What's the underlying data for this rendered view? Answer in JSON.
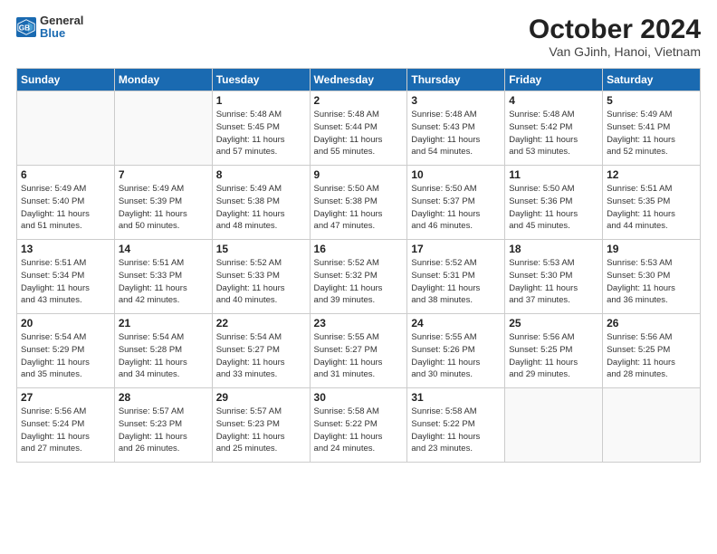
{
  "header": {
    "logo_general": "General",
    "logo_blue": "Blue",
    "title": "October 2024",
    "subtitle": "Van GJinh, Hanoi, Vietnam"
  },
  "weekdays": [
    "Sunday",
    "Monday",
    "Tuesday",
    "Wednesday",
    "Thursday",
    "Friday",
    "Saturday"
  ],
  "weeks": [
    [
      {
        "day": "",
        "info": ""
      },
      {
        "day": "",
        "info": ""
      },
      {
        "day": "1",
        "info": "Sunrise: 5:48 AM\nSunset: 5:45 PM\nDaylight: 11 hours\nand 57 minutes."
      },
      {
        "day": "2",
        "info": "Sunrise: 5:48 AM\nSunset: 5:44 PM\nDaylight: 11 hours\nand 55 minutes."
      },
      {
        "day": "3",
        "info": "Sunrise: 5:48 AM\nSunset: 5:43 PM\nDaylight: 11 hours\nand 54 minutes."
      },
      {
        "day": "4",
        "info": "Sunrise: 5:48 AM\nSunset: 5:42 PM\nDaylight: 11 hours\nand 53 minutes."
      },
      {
        "day": "5",
        "info": "Sunrise: 5:49 AM\nSunset: 5:41 PM\nDaylight: 11 hours\nand 52 minutes."
      }
    ],
    [
      {
        "day": "6",
        "info": "Sunrise: 5:49 AM\nSunset: 5:40 PM\nDaylight: 11 hours\nand 51 minutes."
      },
      {
        "day": "7",
        "info": "Sunrise: 5:49 AM\nSunset: 5:39 PM\nDaylight: 11 hours\nand 50 minutes."
      },
      {
        "day": "8",
        "info": "Sunrise: 5:49 AM\nSunset: 5:38 PM\nDaylight: 11 hours\nand 48 minutes."
      },
      {
        "day": "9",
        "info": "Sunrise: 5:50 AM\nSunset: 5:38 PM\nDaylight: 11 hours\nand 47 minutes."
      },
      {
        "day": "10",
        "info": "Sunrise: 5:50 AM\nSunset: 5:37 PM\nDaylight: 11 hours\nand 46 minutes."
      },
      {
        "day": "11",
        "info": "Sunrise: 5:50 AM\nSunset: 5:36 PM\nDaylight: 11 hours\nand 45 minutes."
      },
      {
        "day": "12",
        "info": "Sunrise: 5:51 AM\nSunset: 5:35 PM\nDaylight: 11 hours\nand 44 minutes."
      }
    ],
    [
      {
        "day": "13",
        "info": "Sunrise: 5:51 AM\nSunset: 5:34 PM\nDaylight: 11 hours\nand 43 minutes."
      },
      {
        "day": "14",
        "info": "Sunrise: 5:51 AM\nSunset: 5:33 PM\nDaylight: 11 hours\nand 42 minutes."
      },
      {
        "day": "15",
        "info": "Sunrise: 5:52 AM\nSunset: 5:33 PM\nDaylight: 11 hours\nand 40 minutes."
      },
      {
        "day": "16",
        "info": "Sunrise: 5:52 AM\nSunset: 5:32 PM\nDaylight: 11 hours\nand 39 minutes."
      },
      {
        "day": "17",
        "info": "Sunrise: 5:52 AM\nSunset: 5:31 PM\nDaylight: 11 hours\nand 38 minutes."
      },
      {
        "day": "18",
        "info": "Sunrise: 5:53 AM\nSunset: 5:30 PM\nDaylight: 11 hours\nand 37 minutes."
      },
      {
        "day": "19",
        "info": "Sunrise: 5:53 AM\nSunset: 5:30 PM\nDaylight: 11 hours\nand 36 minutes."
      }
    ],
    [
      {
        "day": "20",
        "info": "Sunrise: 5:54 AM\nSunset: 5:29 PM\nDaylight: 11 hours\nand 35 minutes."
      },
      {
        "day": "21",
        "info": "Sunrise: 5:54 AM\nSunset: 5:28 PM\nDaylight: 11 hours\nand 34 minutes."
      },
      {
        "day": "22",
        "info": "Sunrise: 5:54 AM\nSunset: 5:27 PM\nDaylight: 11 hours\nand 33 minutes."
      },
      {
        "day": "23",
        "info": "Sunrise: 5:55 AM\nSunset: 5:27 PM\nDaylight: 11 hours\nand 31 minutes."
      },
      {
        "day": "24",
        "info": "Sunrise: 5:55 AM\nSunset: 5:26 PM\nDaylight: 11 hours\nand 30 minutes."
      },
      {
        "day": "25",
        "info": "Sunrise: 5:56 AM\nSunset: 5:25 PM\nDaylight: 11 hours\nand 29 minutes."
      },
      {
        "day": "26",
        "info": "Sunrise: 5:56 AM\nSunset: 5:25 PM\nDaylight: 11 hours\nand 28 minutes."
      }
    ],
    [
      {
        "day": "27",
        "info": "Sunrise: 5:56 AM\nSunset: 5:24 PM\nDaylight: 11 hours\nand 27 minutes."
      },
      {
        "day": "28",
        "info": "Sunrise: 5:57 AM\nSunset: 5:23 PM\nDaylight: 11 hours\nand 26 minutes."
      },
      {
        "day": "29",
        "info": "Sunrise: 5:57 AM\nSunset: 5:23 PM\nDaylight: 11 hours\nand 25 minutes."
      },
      {
        "day": "30",
        "info": "Sunrise: 5:58 AM\nSunset: 5:22 PM\nDaylight: 11 hours\nand 24 minutes."
      },
      {
        "day": "31",
        "info": "Sunrise: 5:58 AM\nSunset: 5:22 PM\nDaylight: 11 hours\nand 23 minutes."
      },
      {
        "day": "",
        "info": ""
      },
      {
        "day": "",
        "info": ""
      }
    ]
  ]
}
